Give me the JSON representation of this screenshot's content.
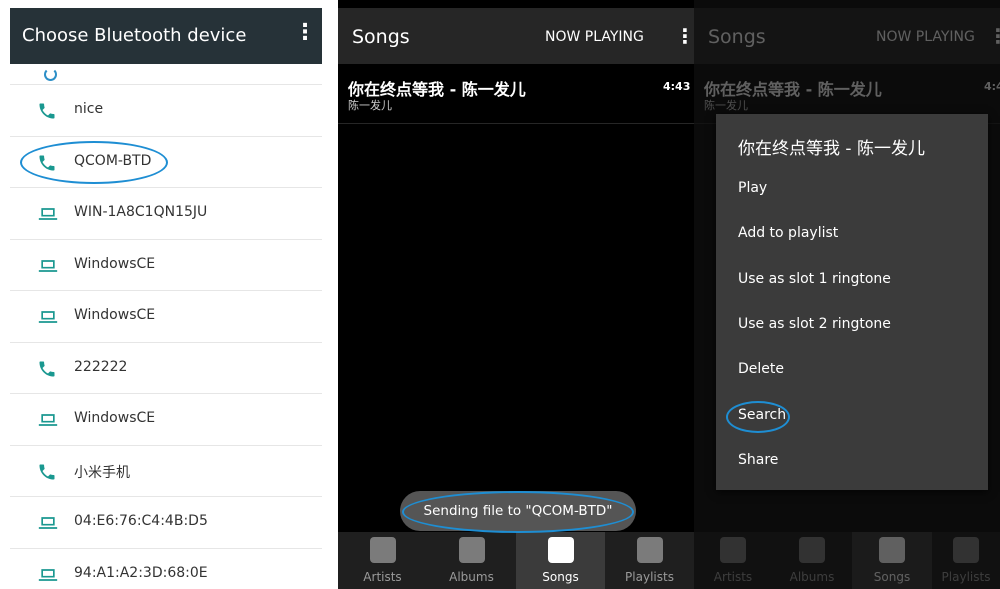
{
  "bluetooth": {
    "title": "Choose Bluetooth device",
    "devices": [
      {
        "name": "nice",
        "icon": "phone-icon"
      },
      {
        "name": "QCOM-BTD",
        "icon": "phone-icon"
      },
      {
        "name": "WIN-1A8C1QN15JU",
        "icon": "laptop-icon"
      },
      {
        "name": "WindowsCE",
        "icon": "laptop-icon"
      },
      {
        "name": "WindowsCE",
        "icon": "laptop-icon"
      },
      {
        "name": "222222",
        "icon": "phone-icon"
      },
      {
        "name": "WindowsCE",
        "icon": "laptop-icon"
      },
      {
        "name": "小米手机",
        "icon": "phone-icon"
      },
      {
        "name": "04:E6:76:C4:4B:D5",
        "icon": "laptop-icon"
      },
      {
        "name": "94:A1:A2:3D:68:0E",
        "icon": "laptop-icon"
      }
    ]
  },
  "songs_screen": {
    "title": "Songs",
    "now_playing": "NOW PLAYING",
    "song": {
      "title": "你在终点等我 - 陈一发儿",
      "artist": "陈一发儿",
      "duration": "4:43"
    },
    "toast": "Sending file to \"QCOM-BTD\"",
    "tabs": [
      {
        "label": "Artists",
        "icon": "microphone-icon"
      },
      {
        "label": "Albums",
        "icon": "album-icon"
      },
      {
        "label": "Songs",
        "icon": "music-note-icon"
      },
      {
        "label": "Playlists",
        "icon": "playlist-icon"
      }
    ],
    "active_tab": "Songs"
  },
  "context_menu": {
    "title": "你在终点等我 - 陈一发儿",
    "items": [
      "Play",
      "Add to playlist",
      "Use as slot 1 ringtone",
      "Use as slot 2 ringtone",
      "Delete",
      "Search",
      "Share"
    ]
  },
  "colors": {
    "accent": "#1a9890",
    "highlight_ring": "#1e8ed3",
    "dark_bar": "#263238"
  }
}
